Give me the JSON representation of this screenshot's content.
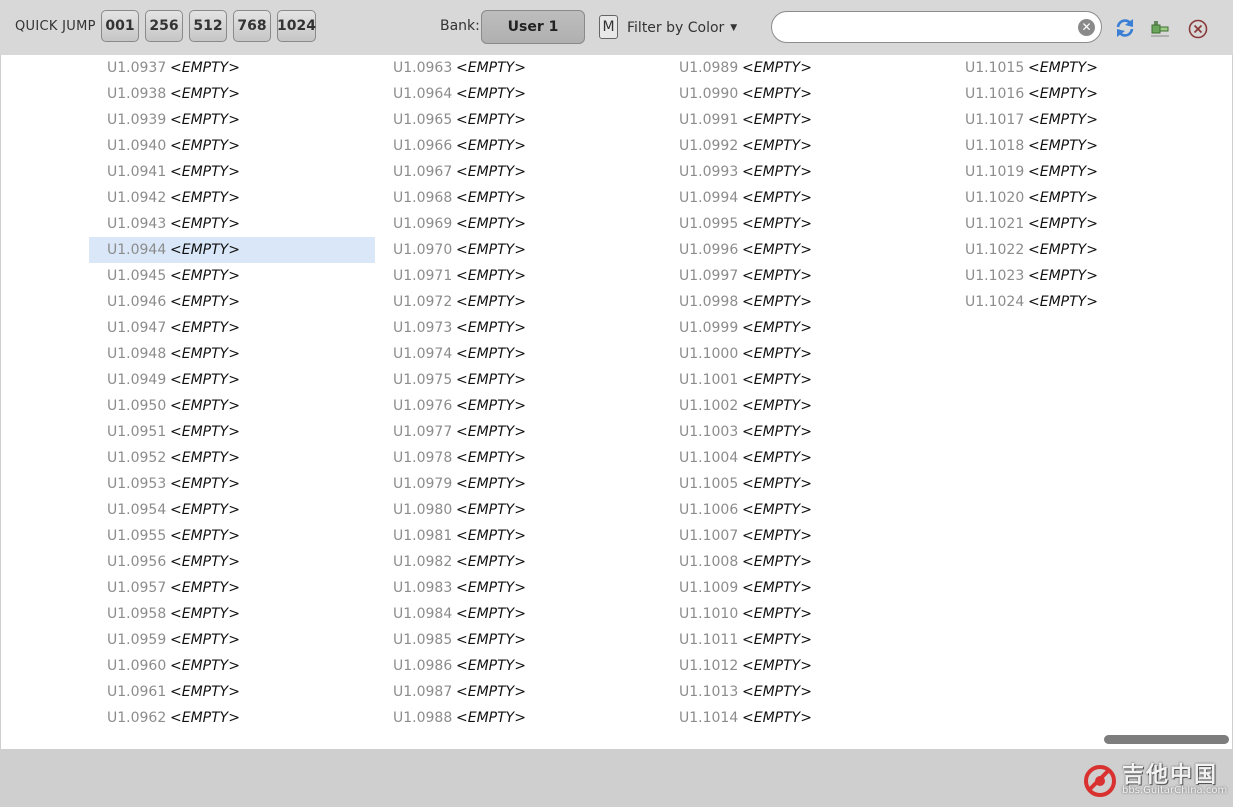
{
  "toolbar": {
    "quick_jump_label": "QUICK JUMP",
    "quick_jump_buttons": [
      "001",
      "256",
      "512",
      "768",
      "1024"
    ],
    "bank_label": "Bank:",
    "bank_value": "User 1",
    "m_label": "M",
    "filter_label": "Filter by Color",
    "search_value": "",
    "icons": [
      "refresh-icon",
      "connect-icon",
      "close-icon"
    ],
    "accent_color": "#3a7fd5"
  },
  "preset_list": {
    "empty_label": "<EMPTY>",
    "selected": "U1.0944",
    "columns": [
      [
        "U1.0937",
        "U1.0938",
        "U1.0939",
        "U1.0940",
        "U1.0941",
        "U1.0942",
        "U1.0943",
        "U1.0944",
        "U1.0945",
        "U1.0946",
        "U1.0947",
        "U1.0948",
        "U1.0949",
        "U1.0950",
        "U1.0951",
        "U1.0952",
        "U1.0953",
        "U1.0954",
        "U1.0955",
        "U1.0956",
        "U1.0957",
        "U1.0958",
        "U1.0959",
        "U1.0960",
        "U1.0961",
        "U1.0962"
      ],
      [
        "U1.0963",
        "U1.0964",
        "U1.0965",
        "U1.0966",
        "U1.0967",
        "U1.0968",
        "U1.0969",
        "U1.0970",
        "U1.0971",
        "U1.0972",
        "U1.0973",
        "U1.0974",
        "U1.0975",
        "U1.0976",
        "U1.0977",
        "U1.0978",
        "U1.0979",
        "U1.0980",
        "U1.0981",
        "U1.0982",
        "U1.0983",
        "U1.0984",
        "U1.0985",
        "U1.0986",
        "U1.0987",
        "U1.0988"
      ],
      [
        "U1.0989",
        "U1.0990",
        "U1.0991",
        "U1.0992",
        "U1.0993",
        "U1.0994",
        "U1.0995",
        "U1.0996",
        "U1.0997",
        "U1.0998",
        "U1.0999",
        "U1.1000",
        "U1.1001",
        "U1.1002",
        "U1.1003",
        "U1.1004",
        "U1.1005",
        "U1.1006",
        "U1.1007",
        "U1.1008",
        "U1.1009",
        "U1.1010",
        "U1.1011",
        "U1.1012",
        "U1.1013",
        "U1.1014"
      ],
      [
        "U1.1015",
        "U1.1016",
        "U1.1017",
        "U1.1018",
        "U1.1019",
        "U1.1020",
        "U1.1021",
        "U1.1022",
        "U1.1023",
        "U1.1024"
      ]
    ]
  },
  "watermark": {
    "text": "吉他中国",
    "url": "bbs.GuitarChina.com"
  }
}
